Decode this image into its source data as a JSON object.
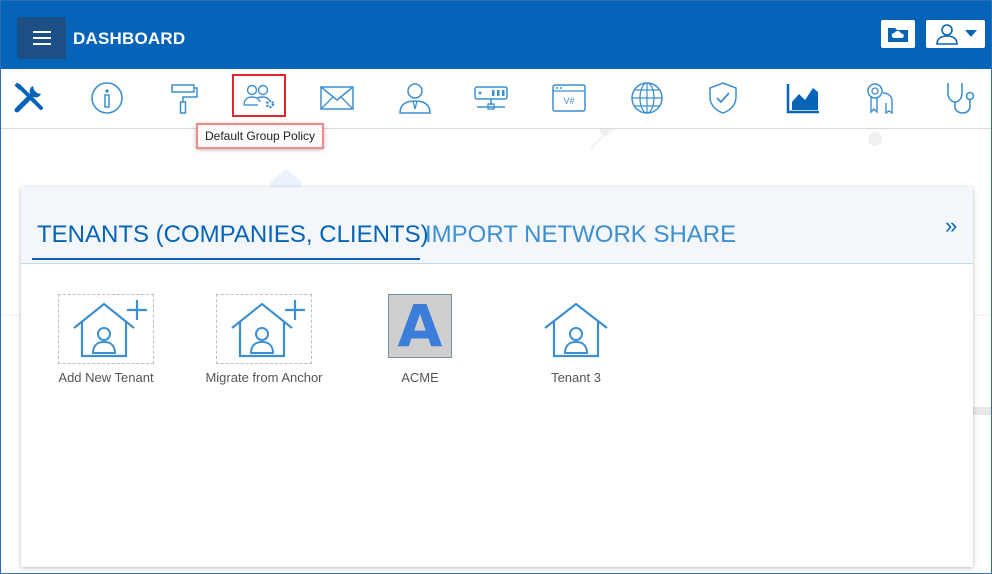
{
  "header": {
    "title": "DASHBOARD",
    "menu_icon": "hamburger-icon",
    "folder_button_icon": "cloud-folder-icon",
    "user_button_icon": "user-icon"
  },
  "toolbar": {
    "tools": [
      {
        "icon": "tools-icon"
      },
      {
        "icon": "info-icon"
      },
      {
        "icon": "paint-roller-icon"
      },
      {
        "icon": "group-policy-icon",
        "active": true
      },
      {
        "icon": "mail-icon"
      },
      {
        "icon": "user-tie-icon"
      },
      {
        "icon": "server-icon"
      },
      {
        "icon": "script-window-icon"
      },
      {
        "icon": "globe-icon"
      },
      {
        "icon": "shield-check-icon"
      },
      {
        "icon": "area-chart-icon"
      },
      {
        "icon": "certificate-keys-icon"
      },
      {
        "icon": "stethoscope-icon"
      }
    ],
    "tooltip": "Default Group Policy",
    "script_window_text": "V#"
  },
  "panel": {
    "tabs": [
      "TENANTS (COMPANIES, CLIENTS)",
      "IMPORT NETWORK SHARE"
    ],
    "active_tab": 0,
    "expand_glyph": "»",
    "tiles": [
      {
        "label": "Add New Tenant",
        "icon": "house-add-icon"
      },
      {
        "label": "Migrate from Anchor",
        "icon": "house-add-icon"
      },
      {
        "label": "ACME",
        "icon": "letter-logo",
        "letter": "A"
      },
      {
        "label": "Tenant 3",
        "icon": "house-user-icon"
      }
    ]
  },
  "colors": {
    "brand": "#0664b8",
    "icon": "#3d8fd0",
    "highlight": "#e0262d"
  }
}
